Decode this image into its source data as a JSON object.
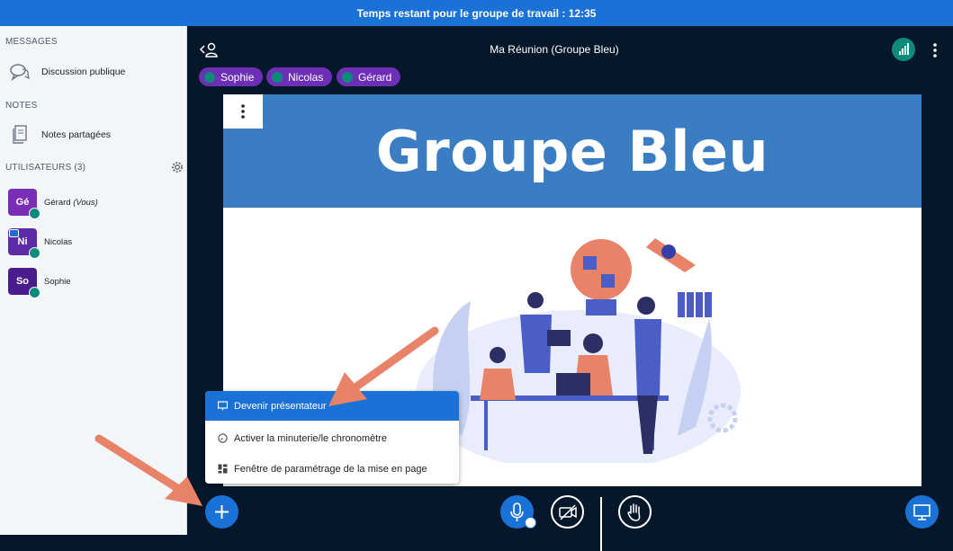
{
  "topbar": {
    "timer_text": "Temps restant pour le groupe de travail : 12:35"
  },
  "sidebar": {
    "messages_title": "MESSAGES",
    "public_chat_label": "Discussion publique",
    "notes_title": "NOTES",
    "shared_notes_label": "Notes partagées",
    "users_title": "UTILISATEURS (3)",
    "users": [
      {
        "initials": "Gé",
        "name": "Gérard",
        "suffix": "(Vous)",
        "color": "#7a2eb5",
        "presenter": false
      },
      {
        "initials": "Ni",
        "name": "Nicolas",
        "suffix": "",
        "color": "#5c2ca8",
        "presenter": true
      },
      {
        "initials": "So",
        "name": "Sophie",
        "suffix": "",
        "color": "#4b1c8c",
        "presenter": false
      }
    ]
  },
  "header": {
    "meeting_title": "Ma Réunion (Groupe Bleu)"
  },
  "talkers": [
    "Sophie",
    "Nicolas",
    "Gérard"
  ],
  "slide": {
    "title": "Groupe Bleu"
  },
  "actions_menu": {
    "items": [
      {
        "label": "Devenir présentateur",
        "icon": "presentation-icon",
        "active": true
      },
      {
        "label": "Activer la minuterie/le chronomètre",
        "icon": "timer-icon",
        "active": false
      },
      {
        "label": "Fenêtre de paramétrage de la mise en page",
        "icon": "layout-icon",
        "active": false
      }
    ]
  },
  "colors": {
    "accent": "#1a71d6",
    "background": "#06172a",
    "talker": "#6c2fb5",
    "status": "#0c8a7a",
    "arrow": "#e8836a"
  }
}
